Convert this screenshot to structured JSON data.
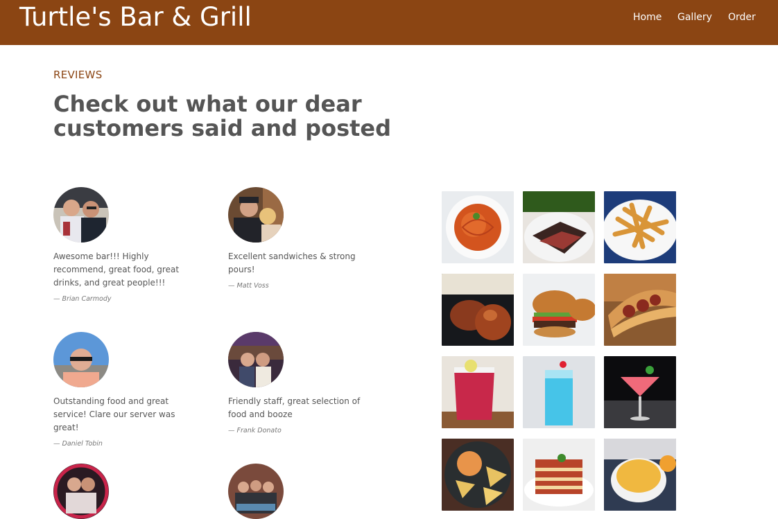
{
  "header": {
    "brand": "Turtle's Bar & Grill",
    "nav": {
      "home": "Home",
      "gallery": "Gallery",
      "order": "Order"
    },
    "colors": {
      "bar": "#8b4513",
      "text": "#ffffff"
    }
  },
  "reviews_section": {
    "label": "REVIEWS",
    "title": "Check out what our dear customers said and posted",
    "items": [
      {
        "text": "Awesome bar!!! Highly recommend, great food, great drinks, and great people!!!",
        "author": "— Brian Carmody"
      },
      {
        "text": "Excellent sandwiches & strong pours!",
        "author": "— Matt Voss"
      },
      {
        "text": "Outstanding food and great service! Clare our server was great!",
        "author": "— Daniel Tobin"
      },
      {
        "text": "Friendly staff, great selection of food and booze",
        "author": "— Frank Donato"
      }
    ]
  },
  "gallery": {
    "items": [
      "spaghetti-photo",
      "steak-photo",
      "fries-photo",
      "chicken-photo",
      "burger-photo",
      "meatball-sub-photo",
      "red-cocktail-photo",
      "blue-drink-photo",
      "martini-photo",
      "nachos-photo",
      "lasagna-photo",
      "mac-and-cheese-photo"
    ]
  }
}
